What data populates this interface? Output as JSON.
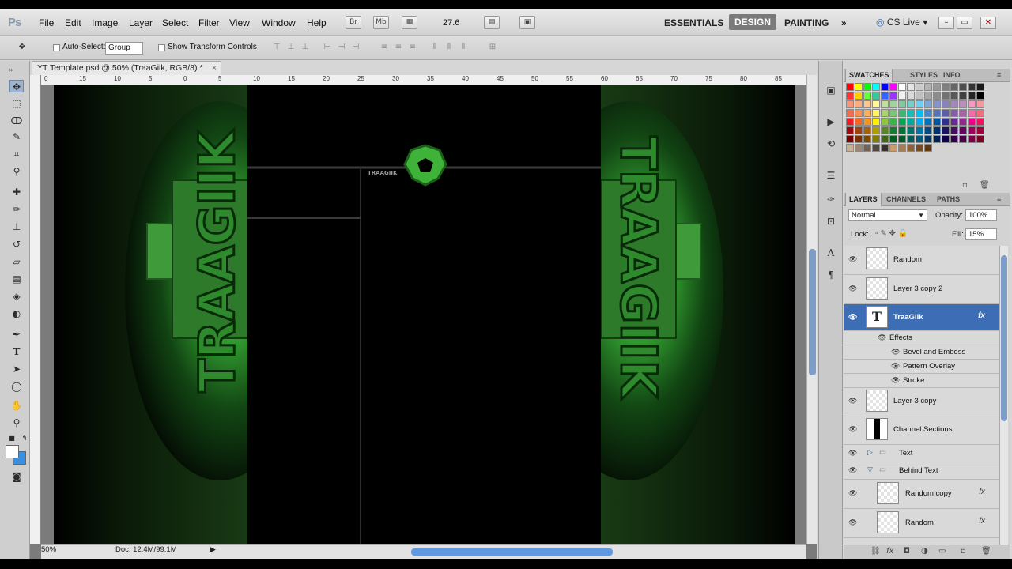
{
  "app": {
    "logo": "Ps"
  },
  "menu": [
    "File",
    "Edit",
    "Image",
    "Layer",
    "Select",
    "Filter",
    "View",
    "Window",
    "Help"
  ],
  "menubar_icons": {
    "bridge": "Br",
    "minibridge": "Mb"
  },
  "zoom_value": "27.6",
  "workspaces": {
    "essentials": "ESSENTIALS",
    "design": "DESIGN",
    "painting": "PAINTING",
    "more": "»"
  },
  "cslive": "CS Live",
  "options": {
    "auto_select_label": "Auto-Select:",
    "auto_select_value": "Group",
    "show_transform_label": "Show Transform Controls"
  },
  "document": {
    "tab_title": "YT Template.psd @ 50% (TraaGiik, RGB/8) *",
    "tab_close": "×",
    "zoom": "50%",
    "doc_info": "Doc: 12.4M/99.1M",
    "ruler_ticks": [
      "0",
      "15",
      "10",
      "5",
      "0",
      "5",
      "10",
      "15",
      "20",
      "25",
      "30",
      "35",
      "40",
      "45",
      "50",
      "55",
      "60",
      "65",
      "70",
      "75",
      "80",
      "85"
    ],
    "banner_small_text": "TRAAGIIK",
    "art_text": "TRAAGIIK"
  },
  "swatch_tabs": [
    "SWATCHES",
    "STYLES",
    "INFO"
  ],
  "swatch_colors": {
    "row1": [
      "#ff0000",
      "#ffff00",
      "#00ff00",
      "#00ffff",
      "#0000ff",
      "#ff00ff",
      "#ffffff",
      "#e6e6e6",
      "#cccccc",
      "#b3b3b3",
      "#999999",
      "#808080",
      "#666666",
      "#4d4d4d",
      "#333333",
      "#1a1a1a"
    ],
    "row2": [
      "#ff3333",
      "#ffcc00",
      "#66ff33",
      "#33cc99",
      "#3366ff",
      "#9933ff",
      "#f2f2f2",
      "#d9d9d9",
      "#bfbfbf",
      "#a6a6a6",
      "#8c8c8c",
      "#737373",
      "#595959",
      "#404040",
      "#262626",
      "#000000"
    ],
    "row3": [
      "#f7977a",
      "#f9ad81",
      "#fdc68a",
      "#fff79a",
      "#c4df9b",
      "#a2d39c",
      "#82ca9d",
      "#7bcdc8",
      "#6ecff6",
      "#7ea7d8",
      "#8493ca",
      "#8882be",
      "#a187be",
      "#bc8dbf",
      "#f49ac2",
      "#f6989d"
    ],
    "row4": [
      "#f26c4f",
      "#f68e55",
      "#fbaf5c",
      "#fff467",
      "#acd372",
      "#7cc576",
      "#3bb878",
      "#1abbb4",
      "#00bff3",
      "#438ccb",
      "#5574b9",
      "#605ca8",
      "#855fa8",
      "#a763a8",
      "#f06ea9",
      "#f26d7d"
    ],
    "row5": [
      "#ed1c24",
      "#f26522",
      "#f7941d",
      "#fff200",
      "#8dc73f",
      "#39b54a",
      "#00a651",
      "#00a99d",
      "#00aeef",
      "#0072bc",
      "#0054a6",
      "#2e3192",
      "#662d91",
      "#92278f",
      "#ec008c",
      "#ed145b"
    ],
    "row6": [
      "#9e0b0f",
      "#a0410d",
      "#a3620a",
      "#aba000",
      "#598527",
      "#1a7b30",
      "#007236",
      "#00746b",
      "#0076a3",
      "#004b80",
      "#003471",
      "#1b1464",
      "#440e62",
      "#630460",
      "#9e005d",
      "#9e0039"
    ],
    "row7": [
      "#790000",
      "#7b2e00",
      "#7d4900",
      "#827b00",
      "#406618",
      "#005e20",
      "#005826",
      "#005952",
      "#005b7f",
      "#003663",
      "#002157",
      "#0d004c",
      "#32004b",
      "#4b0049",
      "#7b0046",
      "#7a0026"
    ],
    "row8": [
      "#c7b299",
      "#998675",
      "#736357",
      "#534741",
      "#37302d",
      "#c69c6d",
      "#a67c52",
      "#8c6239",
      "#754c24",
      "#603913"
    ]
  },
  "layers_tabs": [
    "LAYERS",
    "CHANNELS",
    "PATHS"
  ],
  "blend_mode": "Normal",
  "opacity_label": "Opacity:",
  "opacity_value": "100%",
  "lock_label": "Lock:",
  "fill_label": "Fill:",
  "fill_value": "15%",
  "layers": {
    "random_top": "Random",
    "layer3copy2": "Layer 3 copy 2",
    "traagiik": "TraaGiik",
    "effects": "Effects",
    "bevel": "Bevel and Emboss",
    "pattern": "Pattern Overlay",
    "stroke": "Stroke",
    "layer3copy": "Layer 3 copy",
    "channel_sections": "Channel Sections",
    "text_group": "Text",
    "behind_text": "Behind Text",
    "random_copy": "Random copy",
    "random_bottom": "Random",
    "fx": "fx"
  }
}
